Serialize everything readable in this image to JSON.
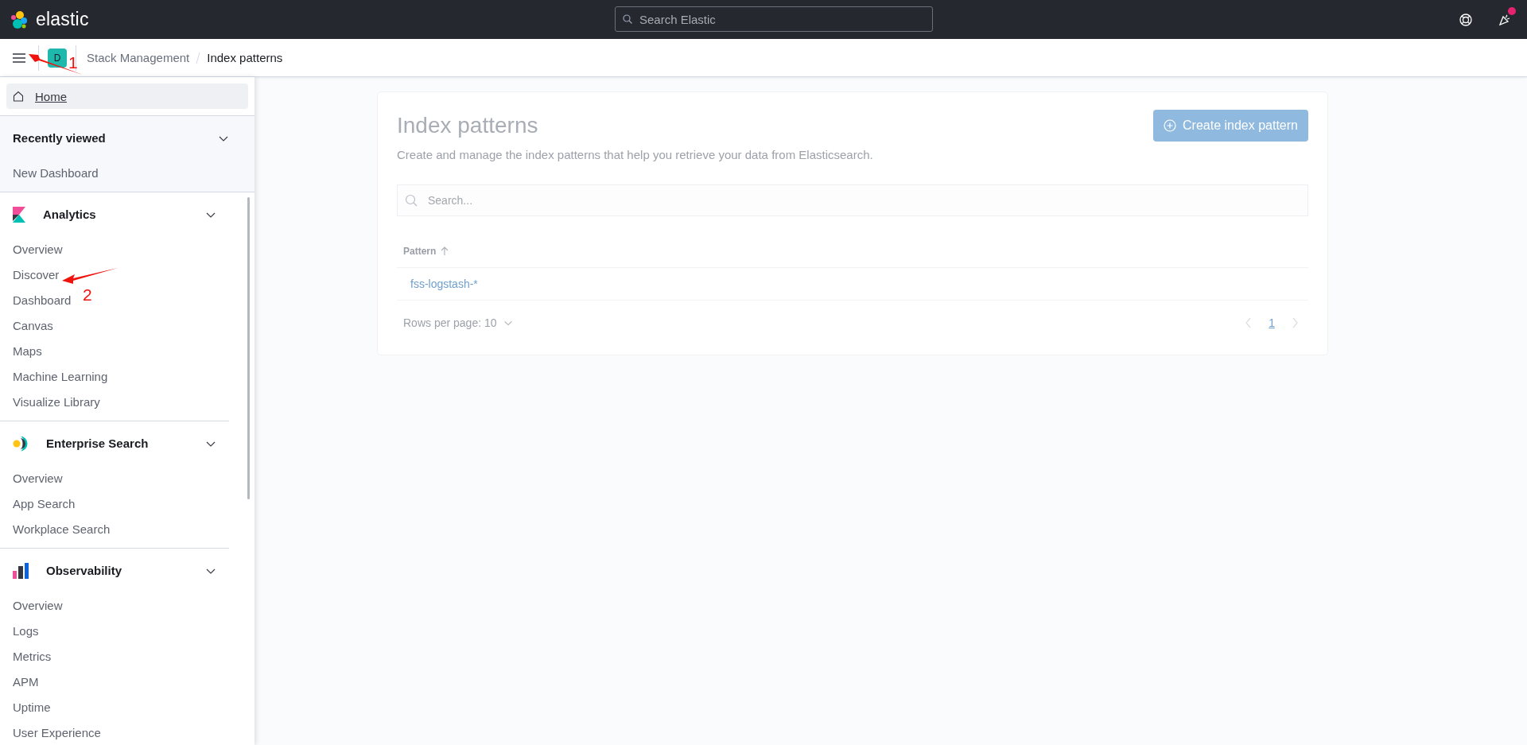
{
  "header": {
    "logo_text": "elastic",
    "search_placeholder": "Search Elastic",
    "news_badge": true
  },
  "breadcrumb_bar": {
    "space_avatar": "D",
    "breadcrumbs": [
      {
        "label": "Stack Management",
        "current": false
      },
      {
        "label": "Index patterns",
        "current": true
      }
    ]
  },
  "nav": {
    "home": {
      "label": "Home",
      "selected": true
    },
    "recently_viewed": {
      "title": "Recently viewed",
      "expanded": true,
      "items": [
        "New Dashboard"
      ]
    },
    "sections": [
      {
        "kind": "analytics",
        "title": "Analytics",
        "expanded": true,
        "items": [
          "Overview",
          "Discover",
          "Dashboard",
          "Canvas",
          "Maps",
          "Machine Learning",
          "Visualize Library"
        ]
      },
      {
        "kind": "enterprise",
        "title": "Enterprise Search",
        "expanded": true,
        "items": [
          "Overview",
          "App Search",
          "Workplace Search"
        ]
      },
      {
        "kind": "observability",
        "title": "Observability",
        "expanded": true,
        "items": [
          "Overview",
          "Logs",
          "Metrics",
          "APM",
          "Uptime",
          "User Experience"
        ]
      }
    ]
  },
  "page": {
    "title": "Index patterns",
    "description": "Create and manage the index patterns that help you retrieve your data from Elasticsearch.",
    "create_button": {
      "label": "Create index pattern",
      "disabled": true
    },
    "search_placeholder": "Search...",
    "columns": [
      "Pattern"
    ],
    "rows": [
      "fss-logstash-*"
    ],
    "rows_per_page": "Rows per page: 10",
    "pages": [
      {
        "label": "1",
        "selected": true
      }
    ]
  },
  "annotations": [
    {
      "label": "1"
    },
    {
      "label": "2"
    }
  ]
}
